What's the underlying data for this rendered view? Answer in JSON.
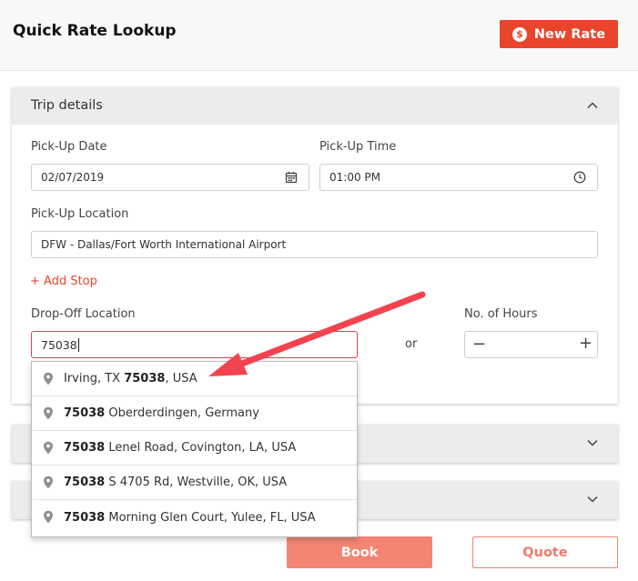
{
  "header": {
    "title": "Quick Rate Lookup",
    "new_rate_label": "New Rate",
    "dollar_symbol": "$"
  },
  "trip": {
    "title": "Trip details",
    "pickup_date_label": "Pick-Up Date",
    "pickup_date_value": "02/07/2019",
    "pickup_time_label": "Pick-Up Time",
    "pickup_time_value": "01:00 PM",
    "pickup_location_label": "Pick-Up Location",
    "pickup_location_value": "DFW - Dallas/Fort Worth International Airport",
    "add_stop_label": "+ Add Stop",
    "dropoff_label": "Drop-Off Location",
    "dropoff_value": "75038",
    "or_label": "or",
    "hours_label": "No. of Hours",
    "minus_label": "−",
    "plus_label": "+"
  },
  "suggestions": [
    {
      "pre": "Irving, TX ",
      "match": "75038",
      "post": ", USA"
    },
    {
      "pre": "",
      "match": "75038",
      "post": " Oberderdingen, Germany"
    },
    {
      "pre": "",
      "match": "75038",
      "post": " Lenel Road, Covington, LA, USA"
    },
    {
      "pre": "",
      "match": "75038",
      "post": " S 4705 Rd, Westville, OK, USA"
    },
    {
      "pre": "",
      "match": "75038",
      "post": " Morning Glen Court, Yulee, FL, USA"
    }
  ],
  "footer": {
    "book_label": "Book",
    "quote_label": "Quote"
  },
  "colors": {
    "accent": "#e8452c",
    "button_light": "#f48473",
    "input_error_border": "#e23b51",
    "annotation_arrow": "#f2434e"
  },
  "icons": {
    "date": "calendar-icon",
    "time": "clock-icon",
    "suggestion": "map-pin-icon",
    "collapse": "chevron-up-icon",
    "expand": "chevron-down-icon"
  }
}
